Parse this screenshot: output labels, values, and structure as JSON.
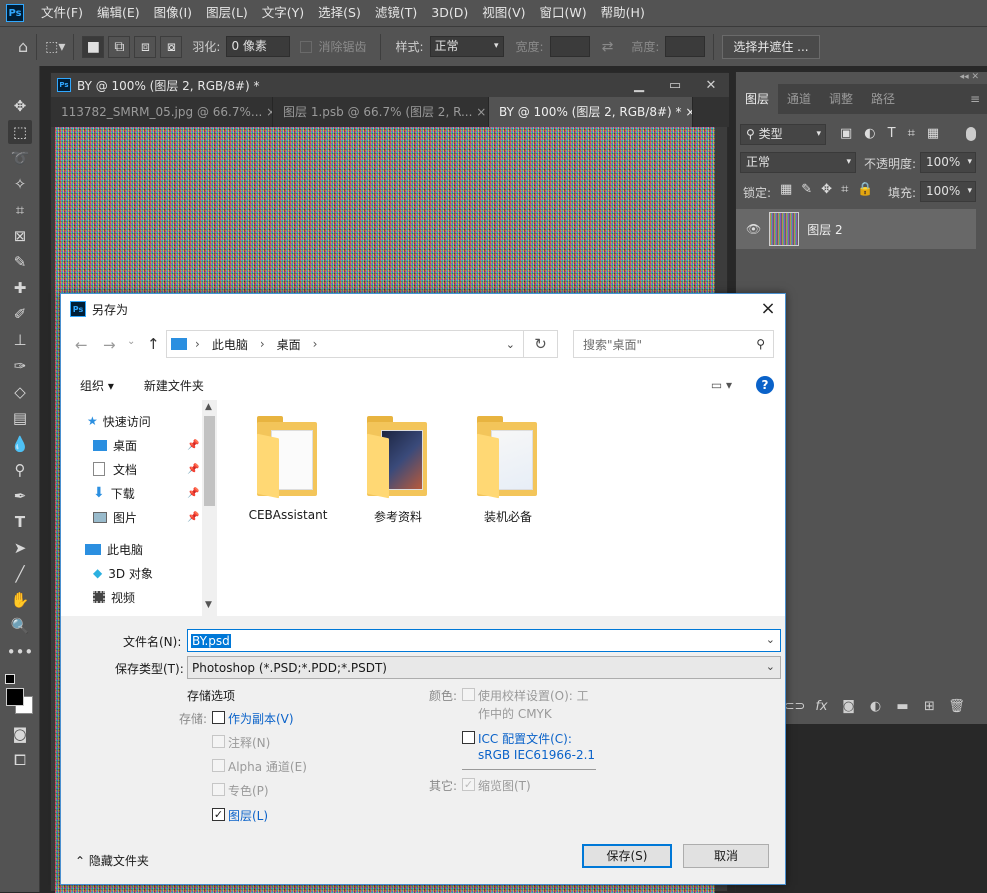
{
  "app": {
    "logo": "Ps"
  },
  "menu": [
    "文件(F)",
    "编辑(E)",
    "图像(I)",
    "图层(L)",
    "文字(Y)",
    "选择(S)",
    "滤镜(T)",
    "3D(D)",
    "视图(V)",
    "窗口(W)",
    "帮助(H)"
  ],
  "options": {
    "feather_label": "羽化:",
    "feather_value": "0 像素",
    "antialias_label": "消除锯齿",
    "style_label": "样式:",
    "style_value": "正常",
    "width_label": "宽度:",
    "height_label": "高度:",
    "select_mask": "选择并遮住 ..."
  },
  "document": {
    "title": "BY @ 100% (图层 2, RGB/8#) *",
    "tabs": [
      {
        "label": "113782_SMRM_05.jpg @ 66.7%...",
        "close": "×"
      },
      {
        "label": "图层 1.psb @ 66.7% (图层 2, R...",
        "close": "×"
      },
      {
        "label": "BY @ 100% (图层 2, RGB/8#) *",
        "close": "×"
      }
    ]
  },
  "panel": {
    "tabs": [
      "图层",
      "通道",
      "调整",
      "路径"
    ],
    "filter_label": "类型",
    "blend_mode": "正常",
    "opacity_label": "不透明度:",
    "opacity_value": "100%",
    "lock_label": "锁定:",
    "fill_label": "填充:",
    "fill_value": "100%",
    "layer_name": "图层 2"
  },
  "dialog": {
    "title": "另存为",
    "close": "×",
    "breadcrumb": [
      "此电脑",
      "桌面"
    ],
    "search_placeholder": "搜索\"桌面\"",
    "organize": "组织 ▾",
    "new_folder": "新建文件夹",
    "help": "?",
    "nav": {
      "quick_access": "快速访问",
      "desktop": "桌面",
      "documents": "文档",
      "downloads": "下载",
      "pictures": "图片",
      "this_pc": "此电脑",
      "objects3d": "3D 对象",
      "videos": "视频"
    },
    "folders": [
      "CEBAssistant",
      "参考资料",
      "装机必备"
    ],
    "filename_label": "文件名(N):",
    "filename_value": "BY.psd",
    "filetype_label": "保存类型(T):",
    "filetype_value": "Photoshop (*.PSD;*.PDD;*.PSDT)",
    "storage_options": "存储选项",
    "storage_label": "存储:",
    "as_copy": "作为副本(V)",
    "notes": "注释(N)",
    "alpha": "Alpha 通道(E)",
    "spot": "专色(P)",
    "layers": "图层(L)",
    "color_label": "颜色:",
    "use_proof": "使用校样设置(O):  工",
    "use_proof_2": "作中的 CMYK",
    "icc": "ICC 配置文件(C):",
    "icc_value": "sRGB IEC61966-2.1",
    "other_label": "其它:",
    "thumbnail": "缩览图(T)",
    "hide_folders": "隐藏文件夹",
    "save": "保存(S)",
    "cancel": "取消"
  }
}
